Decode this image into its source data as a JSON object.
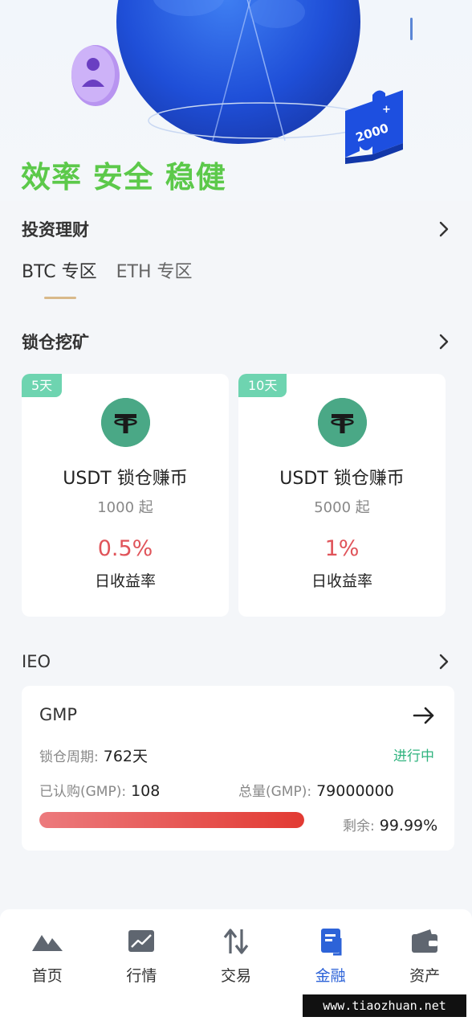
{
  "hero": {
    "slogan": "效率 安全 稳健",
    "puzzle_text": "2000",
    "puzzle_plus": "+"
  },
  "invest": {
    "title": "投资理财",
    "tabs": [
      {
        "label": "BTC 专区",
        "active": true
      },
      {
        "label": "ETH 专区",
        "active": false
      }
    ]
  },
  "mining": {
    "title": "锁仓挖矿",
    "cards": [
      {
        "badge": "5天",
        "name": "USDT 锁仓赚币",
        "min": "1000 起",
        "rate": "0.5%",
        "rate_label": "日收益率"
      },
      {
        "badge": "10天",
        "name": "USDT 锁仓赚币",
        "min": "5000 起",
        "rate": "1%",
        "rate_label": "日收益率"
      }
    ]
  },
  "ieo": {
    "title": "IEO",
    "project": {
      "name": "GMP",
      "period_label": "锁仓周期:",
      "period_value": "762天",
      "status": "进行中",
      "subscribed_label": "已认购(GMP):",
      "subscribed_value": "108",
      "total_label": "总量(GMP):",
      "total_value": "79000000",
      "remaining_label": "剩余:",
      "remaining_value": "99.99%",
      "progress_fraction": 1.0
    }
  },
  "bottom_nav": [
    {
      "label": "首页",
      "icon": "home-icon",
      "active": false
    },
    {
      "label": "行情",
      "icon": "market-chart-icon",
      "active": false
    },
    {
      "label": "交易",
      "icon": "trade-arrows-icon",
      "active": false
    },
    {
      "label": "金融",
      "icon": "finance-book-icon",
      "active": true
    },
    {
      "label": "资产",
      "icon": "wallet-icon",
      "active": false
    }
  ],
  "watermark": "www.tiaozhuan.net",
  "colors": {
    "slogan_green": "#5cc94a",
    "badge_green": "#6ed4b0",
    "coin_green": "#4aa886",
    "rate_red": "#e0545a",
    "status_green": "#2fb37e",
    "nav_active_blue": "#2d63d8"
  }
}
